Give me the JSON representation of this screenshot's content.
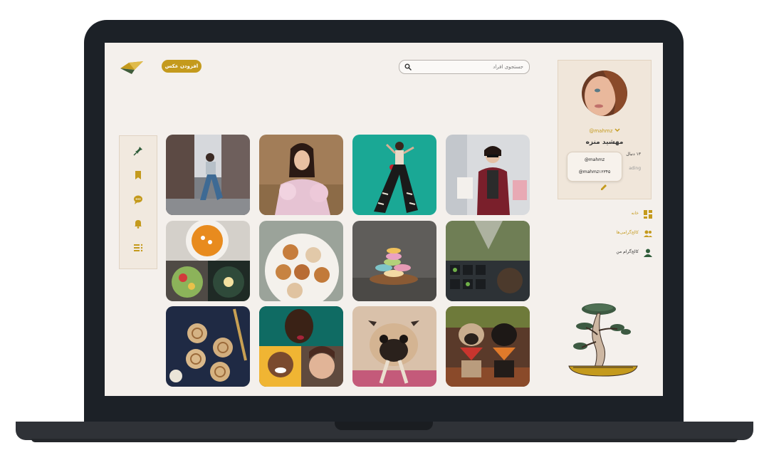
{
  "header": {
    "add_photo_label": "افزودن عکس",
    "search_placeholder": "جستجوی افراد"
  },
  "tools": {
    "icons": [
      "pin-icon",
      "bookmark-icon",
      "chat-icon",
      "bell-icon",
      "list-icon"
    ]
  },
  "photos": [
    {
      "subject": "woman-jumping-city"
    },
    {
      "subject": "woman-sunglasses-field"
    },
    {
      "subject": "woman-teal-background"
    },
    {
      "subject": "woman-shopping-bags"
    },
    {
      "subject": "pumpkin-soup-salads"
    },
    {
      "subject": "pastries-plate"
    },
    {
      "subject": "macarons"
    },
    {
      "subject": "seedlings-watering"
    },
    {
      "subject": "cinnamon-rolls"
    },
    {
      "subject": "portraits-collage"
    },
    {
      "subject": "pug-rope"
    },
    {
      "subject": "pugs-bandanas"
    }
  ],
  "profile": {
    "handle_top": "@mahmz",
    "name": "مهشید منزه",
    "followers": "۱۳ دنبال",
    "following": "ading",
    "popup_items": [
      "@mahmz",
      "@mahmz۱۲۳۴۵"
    ]
  },
  "nav": {
    "items": [
      {
        "label": "خانه",
        "icon": "dashboard-icon"
      },
      {
        "label": "کالج‌گرامی‌ها",
        "icon": "users-icon"
      },
      {
        "label": "کالج‌گرام من",
        "icon": "user-icon"
      }
    ]
  },
  "colors": {
    "accent": "#c49a1d",
    "nav_active": "#c49a1d",
    "nav_text": "#333333",
    "icon_gold": "#c49a1d",
    "icon_green": "#2f5d3a",
    "bezel": "#1c2127",
    "screen_bg": "#f4f0ec"
  }
}
